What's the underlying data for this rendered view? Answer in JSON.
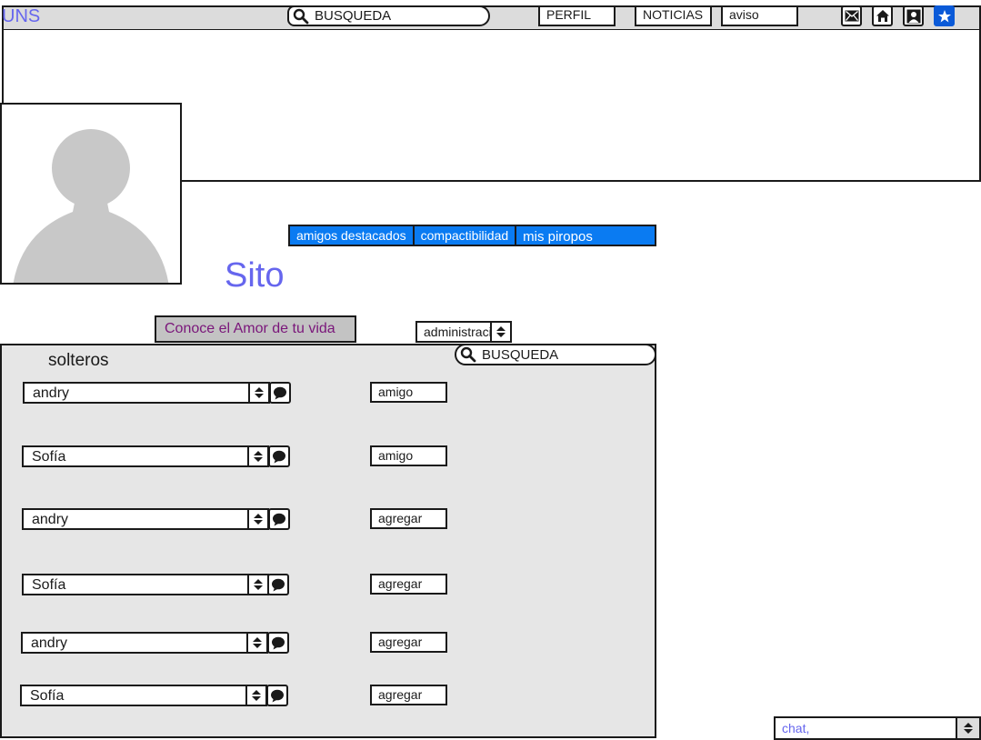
{
  "header": {
    "brand": "UNS",
    "search_placeholder": "BUSQUEDA",
    "nav": {
      "perfil": "PERFIL",
      "noticias": "NOTICIAS",
      "aviso": "aviso"
    },
    "icons": [
      "mail-icon",
      "home-icon",
      "user-icon",
      "star-icon"
    ],
    "accent_color": "#0a5ad8"
  },
  "profile": {
    "name": "Sito",
    "tabs": [
      "amigos destacados",
      "compactibilidad",
      "mis piropos"
    ]
  },
  "promo_button": "Conoce el Amor de tu vida",
  "admin_select": "administración",
  "singles": {
    "title": "solteros",
    "search_placeholder": "BUSQUEDA",
    "rows": [
      {
        "name": "andry",
        "action": "amigo"
      },
      {
        "name": "Sofía",
        "action": "amigo"
      },
      {
        "name": "andry",
        "action": "agregar"
      },
      {
        "name": "Sofía",
        "action": "agregar"
      },
      {
        "name": "andry",
        "action": "agregar"
      },
      {
        "name": "Sofía",
        "action": "agregar"
      }
    ]
  },
  "chat": {
    "value": "chat,"
  },
  "colors": {
    "brand_text": "#6666ee",
    "tab_bg": "#0a7bf2",
    "panel_bg": "#e6e6e6",
    "promo_text": "#7a167a"
  }
}
